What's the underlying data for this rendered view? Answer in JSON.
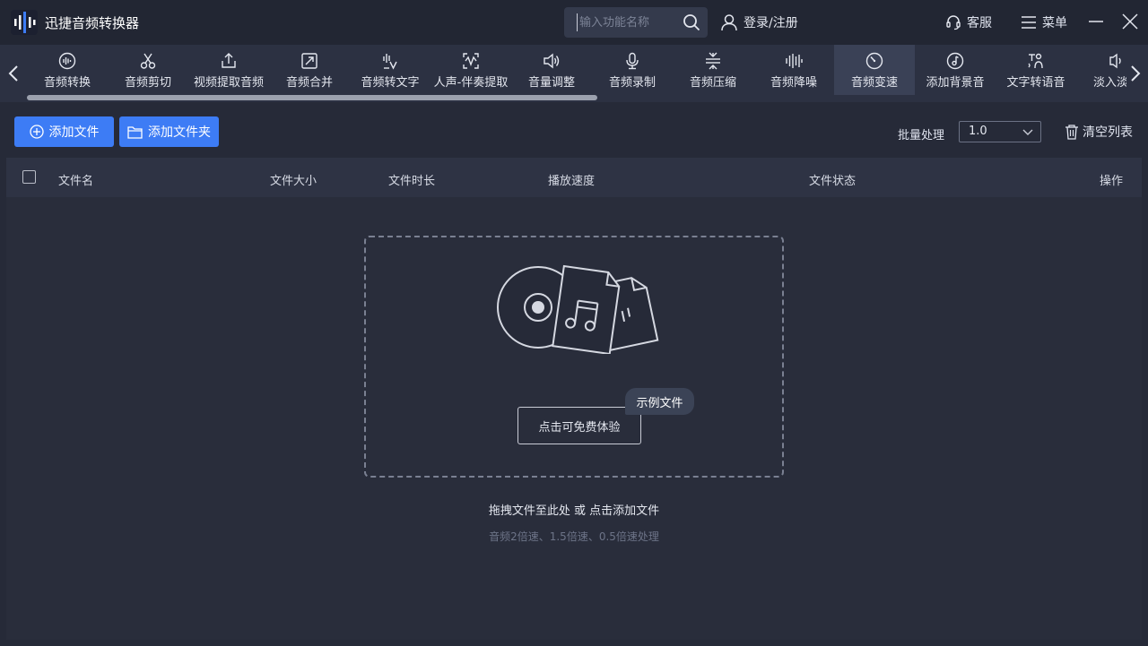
{
  "app": {
    "title": "迅捷音频转换器"
  },
  "search": {
    "placeholder": "输入功能名称"
  },
  "header": {
    "login": "登录/注册",
    "service": "客服",
    "menu": "菜单"
  },
  "tools": [
    {
      "label": "音频转换",
      "icon": "audio-convert-icon"
    },
    {
      "label": "音频剪切",
      "icon": "scissors-icon"
    },
    {
      "label": "视频提取音频",
      "icon": "upload-icon"
    },
    {
      "label": "音频合并",
      "icon": "merge-icon"
    },
    {
      "label": "音频转文字",
      "icon": "audio-to-text-icon"
    },
    {
      "label": "人声-伴奏提取",
      "icon": "vocal-extract-icon"
    },
    {
      "label": "音量调整",
      "icon": "speaker-icon"
    },
    {
      "label": "音频录制",
      "icon": "microphone-icon"
    },
    {
      "label": "音频压缩",
      "icon": "compress-icon"
    },
    {
      "label": "音频降噪",
      "icon": "denoise-icon"
    },
    {
      "label": "音频变速",
      "icon": "speed-dial-icon",
      "active": true
    },
    {
      "label": "添加背景音",
      "icon": "music-note-icon"
    },
    {
      "label": "文字转语音",
      "icon": "text-to-speech-icon"
    },
    {
      "label": "淡入淡出",
      "icon": "fade-icon"
    }
  ],
  "actions": {
    "add_file": "添加文件",
    "add_folder": "添加文件夹",
    "batch_label": "批量处理",
    "batch_value": "1.0",
    "clear_list": "清空列表"
  },
  "table": {
    "headers": {
      "name": "文件名",
      "size": "文件大小",
      "duration": "文件时长",
      "speed": "播放速度",
      "status": "文件状态",
      "ops": "操作"
    }
  },
  "dropzone": {
    "try_button": "点击可免费体验",
    "sample_tag": "示例文件",
    "hint": "拖拽文件至此处 或 点击添加文件",
    "sub_hint": "音频2倍速、1.5倍速、0.5倍速处理"
  },
  "colors": {
    "accent": "#3d7cf5",
    "background": "#262a38",
    "toolbar": "#2c3142",
    "active_tool": "#3a4156"
  }
}
